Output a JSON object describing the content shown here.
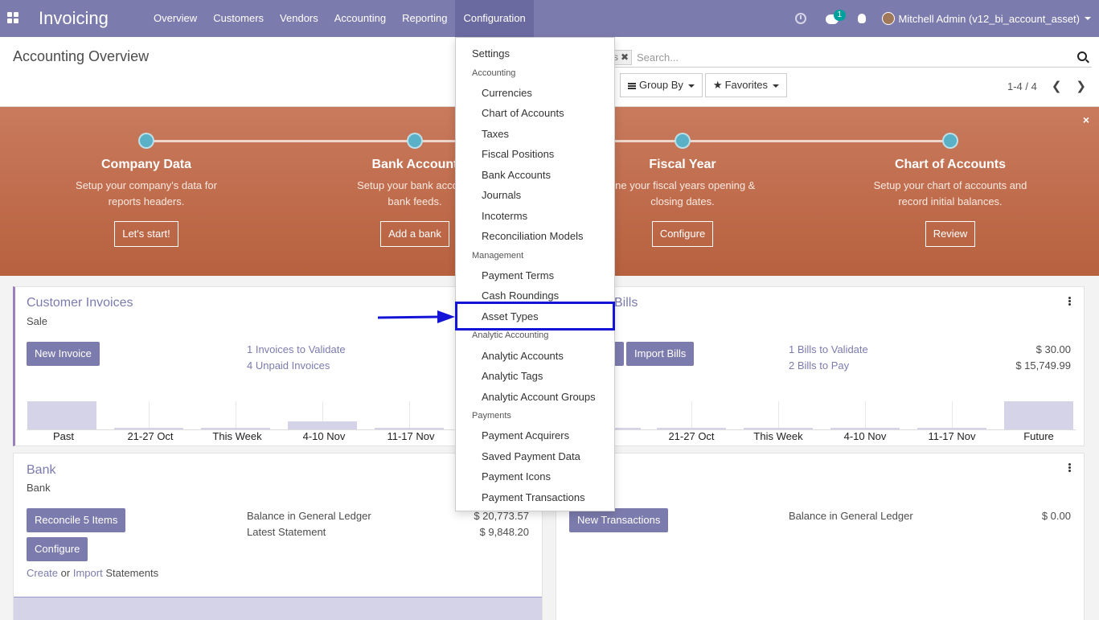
{
  "app": {
    "name": "Invoicing"
  },
  "topnav": {
    "menus": [
      "Overview",
      "Customers",
      "Vendors",
      "Accounting",
      "Reporting",
      "Configuration"
    ],
    "active_menu": "Configuration",
    "chat_count": "1",
    "user": "Mitchell Admin (v12_bi_account_asset)",
    "icons": [
      "apps-icon",
      "clock-icon",
      "chat-icon",
      "bug-icon",
      "avatar"
    ]
  },
  "control_panel": {
    "title": "Accounting Overview",
    "search_facet": "s",
    "search_placeholder": "Search...",
    "group_by": "Group By",
    "favorites": "Favorites",
    "pager": "1-4 / 4"
  },
  "banner": {
    "steps": [
      {
        "title": "Company Data",
        "desc1": "Setup your company's data for",
        "desc2": "reports headers.",
        "button": "Let's start!"
      },
      {
        "title": "Bank Account",
        "desc1": "Setup your bank account",
        "desc2": "bank feeds.",
        "button": "Add a bank"
      },
      {
        "title": "Fiscal Year",
        "desc1": "fine your fiscal years opening &",
        "desc2": "closing dates.",
        "button": "Configure"
      },
      {
        "title": "Chart of Accounts",
        "desc1": "Setup your chart of accounts and",
        "desc2": "record initial balances.",
        "button": "Review"
      }
    ],
    "close": "×"
  },
  "cards": {
    "customer_invoices": {
      "title": "Customer Invoices",
      "subtitle": "Sale",
      "button": "New Invoice",
      "link1": "1 Invoices to Validate",
      "link2": "4 Unpaid Invoices",
      "chart_labels": [
        "Past",
        "21-27 Oct",
        "This Week",
        "4-10 Nov",
        "11-17 Nov"
      ]
    },
    "vendor_bills": {
      "title": "Bills",
      "button": "Import Bills",
      "link1": "1 Bills to Validate",
      "link2": "2 Bills to Pay",
      "amount1": "$ 30.00",
      "amount2": "$ 15,749.99",
      "chart_labels": [
        "21-27 Oct",
        "This Week",
        "4-10 Nov",
        "11-17 Nov",
        "Future"
      ]
    },
    "bank": {
      "title": "Bank",
      "subtitle": "Bank",
      "button1": "Reconcile 5 Items",
      "button2": "Configure",
      "label1": "Balance in General Ledger",
      "label2": "Latest Statement",
      "amount1": "$ 20,773.57",
      "amount2": "$ 9,848.20",
      "create": "Create",
      "or": "or",
      "import": "Import",
      "statements": "Statements"
    },
    "other": {
      "button": "New Transactions",
      "label": "Balance in General Ledger",
      "amount": "$ 0.00"
    }
  },
  "dropdown": {
    "settings": "Settings",
    "sections": [
      {
        "header": "Accounting",
        "items": [
          "Currencies",
          "Chart of Accounts",
          "Taxes",
          "Fiscal Positions",
          "Bank Accounts",
          "Journals",
          "Incoterms",
          "Reconciliation Models"
        ]
      },
      {
        "header": "Management",
        "items": [
          "Payment Terms",
          "Cash Roundings",
          "Asset Types"
        ]
      },
      {
        "header": "Analytic Accounting",
        "items": [
          "Analytic Accounts",
          "Analytic Tags",
          "Analytic Account Groups"
        ]
      },
      {
        "header": "Payments",
        "items": [
          "Payment Acquirers",
          "Saved Payment Data",
          "Payment Icons",
          "Payment Transactions"
        ]
      }
    ],
    "highlighted_item": "Asset Types"
  },
  "colors": {
    "navbar": "#7c7bad",
    "banner": "#c0704f",
    "highlight": "#1414d6",
    "dot": "#5ab0c6"
  }
}
